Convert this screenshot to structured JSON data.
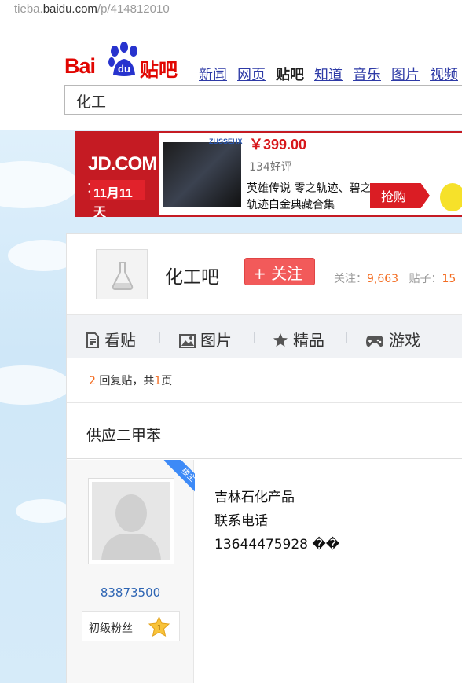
{
  "browser": {
    "url_prefix": "tieba.",
    "url_domain": "baidu.com",
    "url_path": "/p/414812010"
  },
  "header": {
    "logo": {
      "bai": "Bai",
      "du": "du",
      "tieba": "贴吧"
    },
    "nav": [
      "新闻",
      "网页",
      "贴吧",
      "知道",
      "音乐",
      "图片",
      "视频"
    ],
    "nav_active": "贴吧",
    "search_value": "化工"
  },
  "ad": {
    "jd_logo": "JD.COM",
    "jd_cn": "京东",
    "promo": "11月11天",
    "product_logo": "ZUSSEHX",
    "price": "￥399.00",
    "reviews": "134好评",
    "description": "英雄传说 零之轨迹、碧之轨迹白金典藏合集",
    "buy_label": "抢购"
  },
  "forum": {
    "name": "化工吧",
    "follow_label": "+ 关注",
    "followers_label": "关注：",
    "followers": "9,663",
    "posts_label": "贴子：",
    "posts": "15"
  },
  "tabs": [
    {
      "label": "看贴",
      "icon": "document-icon"
    },
    {
      "label": "图片",
      "icon": "image-icon"
    },
    {
      "label": "精品",
      "icon": "star-icon"
    },
    {
      "label": "游戏",
      "icon": "gamepad-icon"
    }
  ],
  "thread": {
    "reply_count": "2",
    "reply_text": " 回复贴，共",
    "page_count": "1",
    "page_text": "页",
    "title": "供应二甲苯"
  },
  "post": {
    "badge": "楼主",
    "username": "83873500",
    "level_name": "初级粉丝",
    "level": "1",
    "lines": [
      "吉林石化产品",
      "联系电话",
      "13644475928 ��"
    ]
  },
  "colors": {
    "brand_red": "#e10602",
    "link_blue": "#2d3aa6",
    "accent_orange": "#f36c21",
    "follow_red": "#f25a5a",
    "badge_blue": "#3d8af7"
  }
}
